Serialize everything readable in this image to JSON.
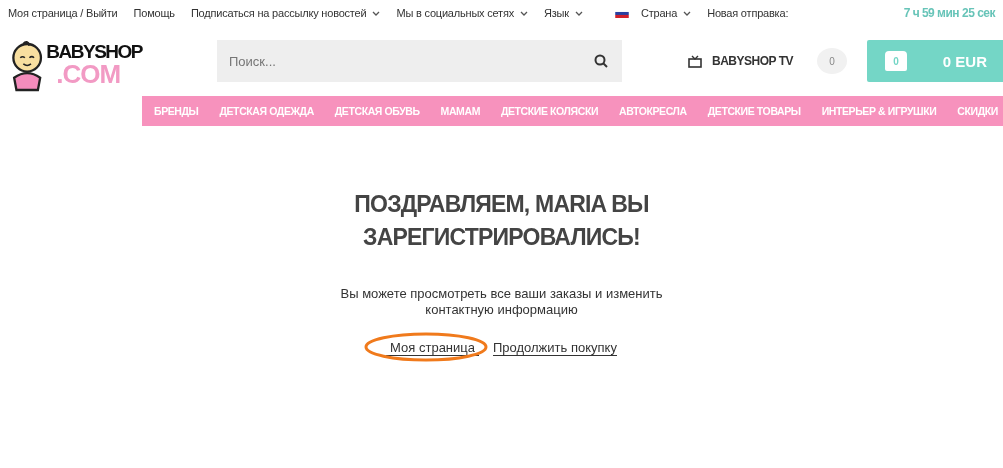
{
  "top_bar": {
    "links": [
      {
        "label": "Моя страница / Выйти",
        "dropdown": false
      },
      {
        "label": "Помощь",
        "dropdown": false
      },
      {
        "label": "Подписаться на рассылку новостей",
        "dropdown": true
      },
      {
        "label": "Мы в социальных сетях",
        "dropdown": true
      },
      {
        "label": "Язык",
        "dropdown": true
      }
    ],
    "country": "Страна",
    "shipping_label": "Новая отправка:",
    "countdown": "7 ч 59 мин 25 сек"
  },
  "header": {
    "logo": {
      "main": "BABYSHOP",
      "sub": ".COM"
    },
    "search": {
      "placeholder": "Поиск..."
    },
    "tv_link": "BABYSHOP TV",
    "wishlist_count": "0",
    "cart": {
      "count": "0",
      "total": "0 EUR"
    }
  },
  "nav": [
    "БРЕНДЫ",
    "ДЕТСКАЯ ОДЕЖДА",
    "ДЕТСКАЯ ОБУВЬ",
    "МАМАМ",
    "ДЕТСКИЕ КОЛЯСКИ",
    "АВТОКРЕСЛА",
    "ДЕТСКИЕ ТОВАРЫ",
    "ИНТЕРЬЕР & ИГРУШКИ",
    "СКИДКИ"
  ],
  "main": {
    "title": "ПОЗДРАВЛЯЕМ, MARIA ВЫ ЗАРЕГИСТРИРОВАЛИСЬ!",
    "text": "Вы можете просмотреть все ваши заказы и изменить контактную информацию",
    "links": [
      "Моя страница",
      "Продолжить покупку"
    ]
  }
}
